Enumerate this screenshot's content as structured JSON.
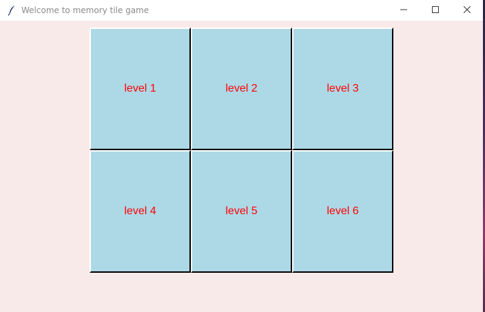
{
  "window": {
    "title": "Welcome to memory tile game",
    "background": "#f8eae9"
  },
  "titlebar": {
    "app_icon": "feather-icon",
    "minimize_icon": "minimize-icon",
    "maximize_icon": "maximize-icon",
    "close_icon": "close-icon"
  },
  "levels": {
    "tile_color": "#add8e6",
    "label_color": "#ff0000",
    "items": [
      {
        "label": "level 1"
      },
      {
        "label": "level 2"
      },
      {
        "label": "level 3"
      },
      {
        "label": "level 4"
      },
      {
        "label": "level 5"
      },
      {
        "label": "level 6"
      }
    ]
  }
}
